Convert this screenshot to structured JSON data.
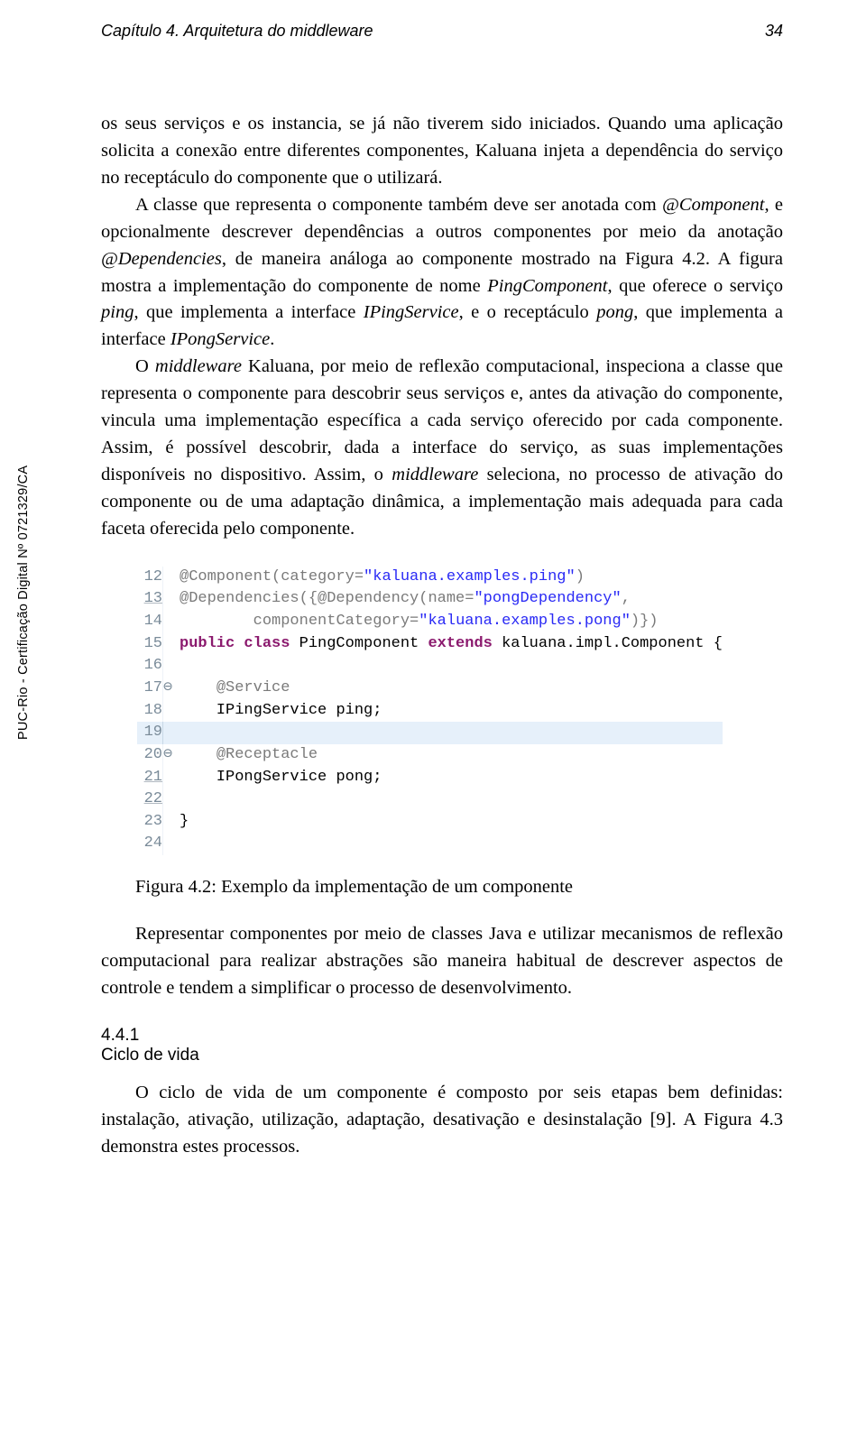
{
  "header": {
    "left": "Capítulo 4. Arquitetura do middleware",
    "right": "34"
  },
  "side_note": "PUC-Rio - Certificação Digital Nº 0721329/CA",
  "para": {
    "p1a": "os seus serviços e os instancia, se já não tiverem sido iniciados. Quando uma aplicação solicita a conexão entre diferentes componentes, Kaluana injeta a dependência do serviço no receptáculo do componente que o utilizará.",
    "p2a": "A classe que representa o componente também deve ser anotada com ",
    "p2b": "@Component",
    "p2c": ", e opcionalmente descrever dependências a outros componentes por meio da anotação ",
    "p2d": "@Dependencies",
    "p2e": ", de maneira análoga ao componente mostrado na Figura 4.2. A figura mostra a implementação do componente de nome ",
    "p2f": "PingComponent",
    "p2g": ", que oferece o serviço ",
    "p2h": "ping",
    "p2i": ", que implementa a interface ",
    "p2j": "IPingService",
    "p2k": ", e o receptáculo ",
    "p2l": "pong",
    "p2m": ", que implementa a interface ",
    "p2n": "IPongService",
    "p2o": ".",
    "p3a": "O ",
    "p3b": "middleware",
    "p3c": " Kaluana, por meio de reflexão computacional, inspeciona a classe que representa o componente para descobrir seus serviços e, antes da ativação do componente, vincula uma implementação específica a cada serviço oferecido por cada componente. Assim, é possível descobrir, dada a interface do serviço, as suas implementações disponíveis no dispositivo. Assim, o ",
    "p3d": "middleware",
    "p3e": " seleciona, no processo de ativação do componente ou de uma adaptação dinâmica, a implementação mais adequada para cada faceta oferecida pelo componente.",
    "p4": "Representar componentes por meio de classes Java e utilizar mecanismos de reflexão computacional para realizar abstrações são maneira habitual de descrever aspectos de controle e tendem a simplificar o processo de desenvolvimento.",
    "p5": "O ciclo de vida de um componente é composto por seis etapas bem definidas: instalação, ativação, utilização, adaptação, desativação e desinstalação [9]. A Figura 4.3 demonstra estes processos."
  },
  "code": {
    "lines": [
      {
        "n": "12",
        "fold": "",
        "t": [
          {
            "c": "code-ann",
            "s": "@Component(category="
          },
          {
            "c": "code-str",
            "s": "\"kaluana.examples.ping\""
          },
          {
            "c": "code-ann",
            "s": ")"
          }
        ]
      },
      {
        "n": "13",
        "u": true,
        "fold": "",
        "t": [
          {
            "c": "code-ann",
            "s": "@Dependencies({@Dependency(name="
          },
          {
            "c": "code-str",
            "s": "\"pongDependency\""
          },
          {
            "c": "code-ann",
            "s": ","
          }
        ]
      },
      {
        "n": "14",
        "fold": "",
        "t": [
          {
            "c": "",
            "s": "        "
          },
          {
            "c": "code-ann",
            "s": "componentCategory="
          },
          {
            "c": "code-str",
            "s": "\"kaluana.examples.pong\""
          },
          {
            "c": "code-ann",
            "s": ")})"
          }
        ]
      },
      {
        "n": "15",
        "fold": "",
        "t": [
          {
            "c": "code-kw",
            "s": "public class"
          },
          {
            "c": "",
            "s": " PingComponent "
          },
          {
            "c": "code-kw",
            "s": "extends"
          },
          {
            "c": "",
            "s": " kaluana.impl.Component {"
          }
        ]
      },
      {
        "n": "16",
        "fold": "",
        "t": []
      },
      {
        "n": "17",
        "fold": "⊖",
        "t": [
          {
            "c": "",
            "s": "    "
          },
          {
            "c": "code-ann",
            "s": "@Service"
          }
        ]
      },
      {
        "n": "18",
        "fold": "",
        "t": [
          {
            "c": "",
            "s": "    IPingService "
          },
          {
            "c": "code-type",
            "s": "ping"
          },
          {
            "c": "",
            "s": ";"
          }
        ]
      },
      {
        "n": "19",
        "hl": true,
        "fold": "",
        "t": []
      },
      {
        "n": "20",
        "fold": "⊖",
        "t": [
          {
            "c": "",
            "s": "    "
          },
          {
            "c": "code-ann",
            "s": "@Receptacle"
          }
        ]
      },
      {
        "n": "21",
        "u": true,
        "fold": "",
        "t": [
          {
            "c": "",
            "s": "    IPongService "
          },
          {
            "c": "code-type",
            "s": "pong"
          },
          {
            "c": "",
            "s": ";"
          }
        ]
      },
      {
        "n": "22",
        "u": true,
        "fold": "",
        "t": []
      },
      {
        "n": "23",
        "fold": "",
        "t": [
          {
            "c": "",
            "s": "}"
          }
        ]
      },
      {
        "n": "24",
        "fold": "",
        "t": []
      }
    ]
  },
  "fig_caption": "Figura 4.2: Exemplo da implementação de um componente",
  "section": {
    "num": "4.4.1",
    "title": "Ciclo de vida"
  }
}
